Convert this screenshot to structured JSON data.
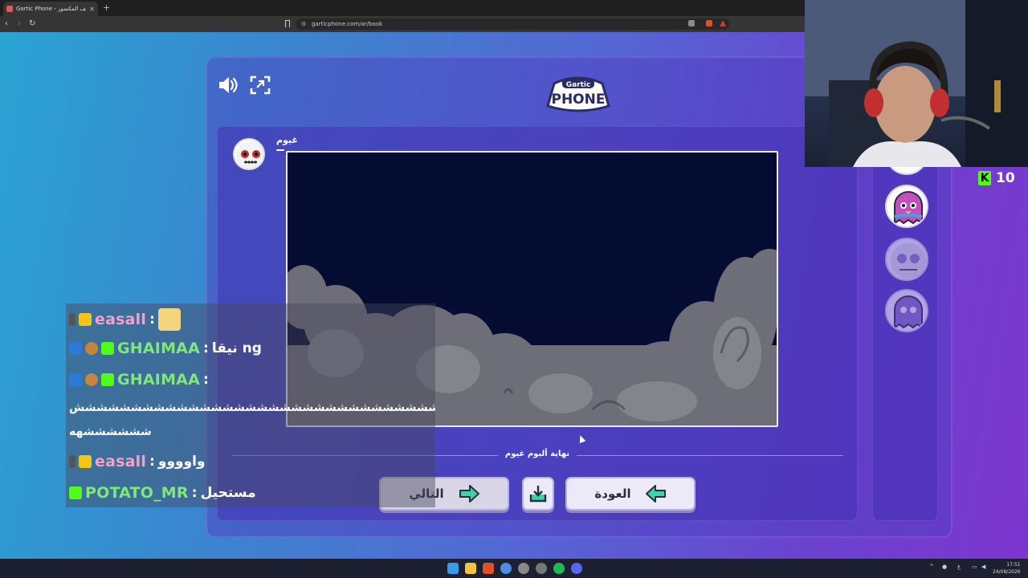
{
  "browser": {
    "tab_title": "Gartic Phone - الهاتف المكسور",
    "new_tab": "+",
    "url": "garticphone.com/ar/book"
  },
  "game": {
    "author": "غيوم",
    "album_end": "نهاية ألبوم غيوم",
    "next_label": "التالي",
    "back_label": "العودة",
    "logo_top": "Gartic",
    "logo_bottom": "PHONE"
  },
  "chat": {
    "messages": [
      {
        "user": "easall",
        "sep": ":",
        "text": "",
        "color": "#f5a0c8"
      },
      {
        "user": "GHAIMAA",
        "sep": ":",
        "text": "نيقا ng",
        "color": "#7ee87a"
      },
      {
        "user": "GHAIMAA",
        "sep": ":",
        "text": "",
        "color": "#7ee87a"
      },
      {
        "user": "easall",
        "sep": ":",
        "text": "واوووو",
        "color": "#f5a0c8"
      },
      {
        "user": "POTATO_MR",
        "sep": ":",
        "text": "مستحيل",
        "color": "#7ee87a"
      }
    ],
    "spam_line1": "ششششششششششششششششششششششششششششششششششششششششششششششش",
    "spam_line2": "ششششششهه"
  },
  "stream": {
    "viewers": "10",
    "kick_letter": "K"
  },
  "taskbar": {
    "clock_time": "17:51",
    "clock_date": "24/08/2026"
  },
  "colors": {
    "kick_green": "#53fc18",
    "canvas_bg": "#040c32",
    "crown": "#f5c518"
  }
}
